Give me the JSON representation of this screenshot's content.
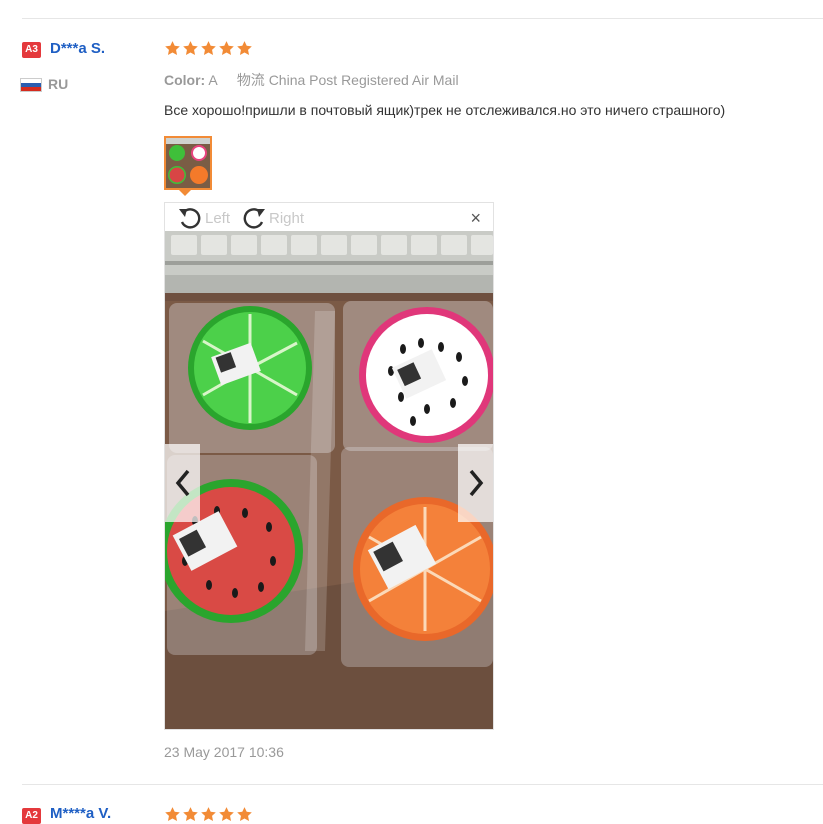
{
  "reviews": [
    {
      "level": "A3",
      "name": "D***a S.",
      "country": "RU",
      "rating": 5,
      "color_label": "Color:",
      "color_value": "A",
      "shipping": "物流 China Post Registered Air Mail",
      "text": "Все хорошо!пришли в почтовый ящик)трек не отслеживался.но это ничего страшного)",
      "viewer": {
        "rotate_left": "Left",
        "rotate_right": "Right",
        "close": "×"
      },
      "date": "23 May 2017 10:36"
    },
    {
      "level": "A2",
      "name": "M****a V.",
      "rating": 5
    }
  ],
  "colors": {
    "badge": "#e4393c",
    "name": "#1f5fc4",
    "star": "#f28b36",
    "muted": "#999999"
  },
  "icons": [
    "star-icon",
    "russia-flag-icon",
    "rotate-left-icon",
    "rotate-right-icon",
    "close-icon",
    "chevron-left-icon",
    "chevron-right-icon"
  ]
}
